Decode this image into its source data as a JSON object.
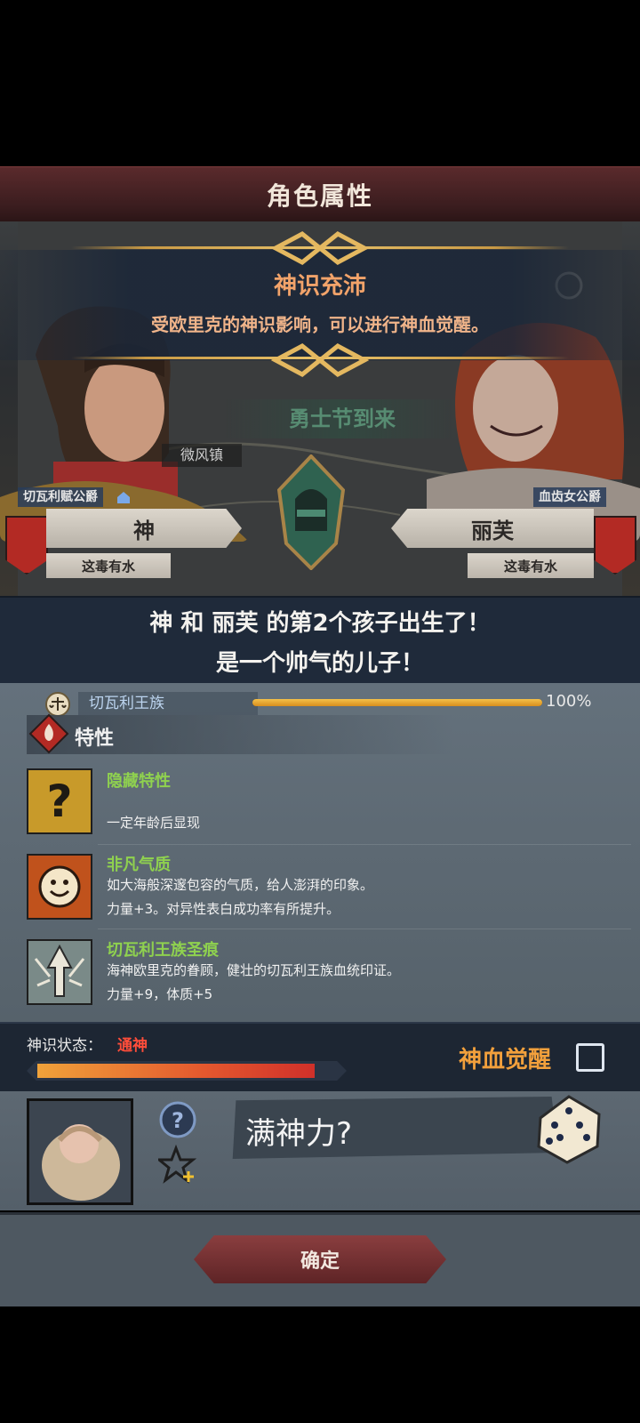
{
  "header": {
    "title": "角色属性"
  },
  "banner": {
    "title": "神识充沛",
    "subtitle": "受欧里克的神识影响，可以进行神血觉醒。"
  },
  "scene": {
    "event_text": "勇士节到来",
    "town": "微风镇"
  },
  "father": {
    "title": "切瓦利赋公爵",
    "name": "神",
    "status": "这毒有水"
  },
  "mother": {
    "title": "血齿女公爵",
    "name": "丽芙",
    "status": "这毒有水"
  },
  "announcement": {
    "line1": "神 和 丽芙 的第2个孩子出生了！",
    "line2": "是一个帅气的儿子！"
  },
  "lineage": {
    "name": "切瓦利王族",
    "percent_label": "100%",
    "percent": 100
  },
  "traits": {
    "section_title": "特性",
    "items": [
      {
        "name": "隐藏特性",
        "desc1": "",
        "desc2": "一定年龄后显现",
        "icon": "question-icon"
      },
      {
        "name": "非凡气质",
        "desc1": "如大海般深邃包容的气质，给人澎湃的印象。",
        "desc2": "力量+3。对异性表白成功率有所提升。",
        "icon": "smile-sun-icon"
      },
      {
        "name": "切瓦利王族圣痕",
        "desc1": "海神欧里克的眷顾，健壮的切瓦利王族血统印证。",
        "desc2": "力量+9，体质+5",
        "icon": "royal-mark-icon"
      }
    ]
  },
  "divine_state": {
    "label": "神识状态：",
    "value": "通神",
    "progress": 0.93
  },
  "awaken": {
    "label": "神血觉醒",
    "checked": false
  },
  "child": {
    "name": "满神力?"
  },
  "actions": {
    "confirm": "确定"
  },
  "colors": {
    "trait_name": "#8fd14f",
    "state_value": "#ff4d3a",
    "awaken": "#f2a03c",
    "banner_title": "#f2a36a"
  }
}
